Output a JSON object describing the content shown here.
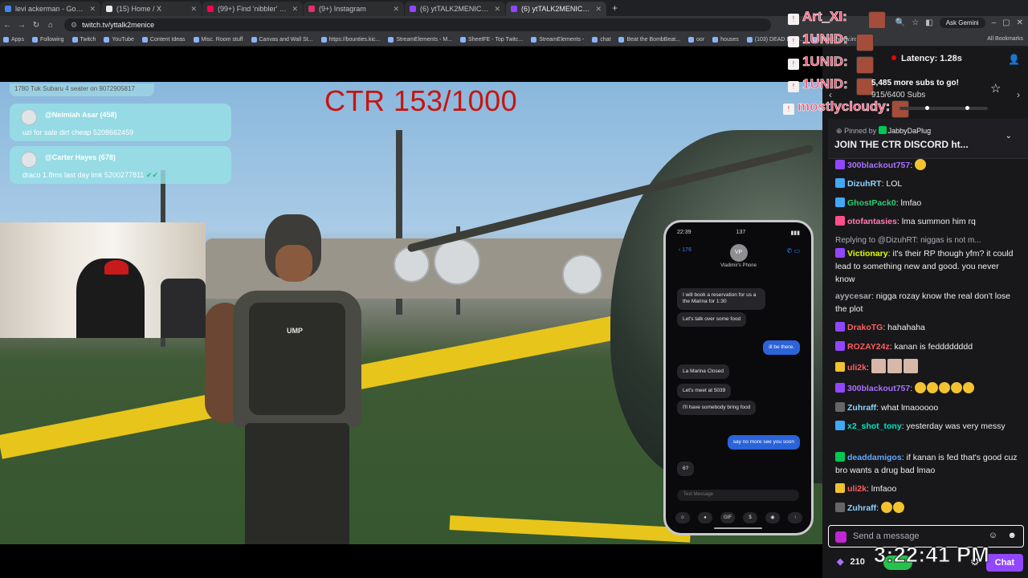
{
  "browser": {
    "tabs": [
      {
        "label": "levi ackerman - Google Search",
        "color": "#4285f4"
      },
      {
        "label": "(15) Home / X",
        "color": "#e7e9ea"
      },
      {
        "label": "(99+) Find 'nibbler' on TikTok",
        "color": "#ff0050"
      },
      {
        "label": "(9+) Instagram",
        "color": "#e1306c"
      },
      {
        "label": "(6) ytTALK2MENICE - Twitch",
        "color": "#9147ff"
      },
      {
        "label": "(6) ytTALK2MENICE - Twitch",
        "color": "#9147ff"
      }
    ],
    "new_tab": "+",
    "url": "twitch.tv/yttalk2menice",
    "ask_gemini": "Ask Gemini",
    "bookmarks": [
      "Apps",
      "Following",
      "Twitch",
      "YouTube",
      "Content Ideas",
      "Misc. Room stuff",
      "Canvas and Wall St...",
      "https://bounties.kic...",
      "StreamElements - M...",
      "SheetFE - Top Twitc...",
      "StreamElements -",
      "chat",
      "Beat the BombBeat...",
      "oor",
      "houses",
      "(103) DEAD BY D...",
      "https://www.instagr..."
    ],
    "all_bookmarks": "All Bookmarks"
  },
  "game": {
    "counter": "CTR 153/1000",
    "notif_top": "1780 Tuk Subaru 4 seater on 9072905817",
    "notifications": [
      {
        "title": "@Neimiah Asar (458)",
        "body": "uzi for sale dirt cheap 5208662459"
      },
      {
        "title": "@Carter Hayes (678)",
        "body": "draco 1.8ms last day lmk 5200277811",
        "tick": "✔✔"
      }
    ],
    "vest_label": "UMP",
    "phone": {
      "time": "22:39",
      "battery": "137",
      "back": "176",
      "avatar": "VP",
      "contact": "Vladimir's Phone",
      "messages": [
        {
          "dir": "in",
          "text": "I will book a reservation for us a the Marina for 1:30"
        },
        {
          "dir": "in",
          "text": "Let's talk over some food"
        },
        {
          "dir": "out",
          "text": "ill be there."
        },
        {
          "dir": "in",
          "text": "La Marina Closed"
        },
        {
          "dir": "in",
          "text": "Let's meet at 5039"
        },
        {
          "dir": "in",
          "text": "I'll have somebody bring food"
        },
        {
          "dir": "out",
          "text": "say no more see you soon"
        },
        {
          "dir": "in",
          "text": "6?"
        }
      ],
      "input_placeholder": "Text Message",
      "actions": [
        "☺",
        "●",
        "GIF",
        "$",
        "◉",
        "↑"
      ]
    }
  },
  "chat": {
    "overlay_names": [
      "Art_XI:",
      "1UNID:",
      "1UNID:",
      "1UNID:",
      "mostlycloudy:"
    ],
    "latency": "Latency: 1.28s",
    "subs_goal": "5,485 more subs to go!",
    "subs_count": "915/6400 Subs",
    "pinned_by_label": "Pinned by",
    "pinned_by_user": "JabbyDaPlug",
    "pinned_text": "JOIN THE CTR DISCORD ht...",
    "messages": [
      {
        "user": "300blackout757",
        "color": "#a970ff",
        "text": ":",
        "emotes": 1,
        "badge": "#9147ff"
      },
      {
        "user": "DizuhRT",
        "color": "#8fd3ff",
        "text": ": LOL",
        "badge": "#3fa9f5"
      },
      {
        "user": "GhostPack0",
        "color": "#2ecc71",
        "text": ": lmfao",
        "badge": "#3fa9f5"
      },
      {
        "user": "otofantasies",
        "color": "#ff7eb6",
        "text": ": lma summon him rq",
        "badge": "#ff4f8b"
      },
      {
        "reply": "Replying to @DizuhRT: niggas is not m...",
        "user": "Victionary",
        "color": "#e1ff00",
        "text": ": it's their RP though yfm? it could lead to something new and good. you never know",
        "badge": "#9147ff"
      },
      {
        "user": "ayycesar",
        "color": "#a8a8b0",
        "text": ": nigga rozay know the real don't lose the plot"
      },
      {
        "user": "DrakoTG",
        "color": "#ff5e5e",
        "text": ": hahahaha",
        "badge": "#9147ff"
      },
      {
        "user": "ROZAY24z",
        "color": "#ff5e5e",
        "text": ": kanan is fedddddddd",
        "badge": "#9147ff"
      },
      {
        "user": "uli2k",
        "color": "#ff5e5e",
        "text": ":",
        "emotes_sq": 3,
        "badge": "#f2c230"
      },
      {
        "user": "300blackout757",
        "color": "#a970ff",
        "text": ":",
        "emotes": 5,
        "badge": "#9147ff"
      },
      {
        "user": "Zuhraff",
        "color": "#8fd3ff",
        "text": ": what lmaooooo",
        "badge": "#666"
      },
      {
        "user": "x2_shot_tony",
        "color": "#00e5c7",
        "text": ": yesterday was very messy",
        "badge": "#3fa9f5"
      },
      {
        "user": "deaddamigos",
        "color": "#61a8ff",
        "text": ": if kanan is fed that's good cuz bro wants a drug bad lmao",
        "badge": "#00c853"
      },
      {
        "user": "uli2k",
        "color": "#ff5e5e",
        "text": ": lmfaoo",
        "badge": "#f2c230"
      },
      {
        "user": "Zuhraff",
        "color": "#8fd3ff",
        "text": ":",
        "emotes": 2,
        "badge": "#666"
      }
    ],
    "send_placeholder": "Send a message",
    "points": "210",
    "chat_button": "Chat",
    "clock": "3:22:41 PM"
  }
}
